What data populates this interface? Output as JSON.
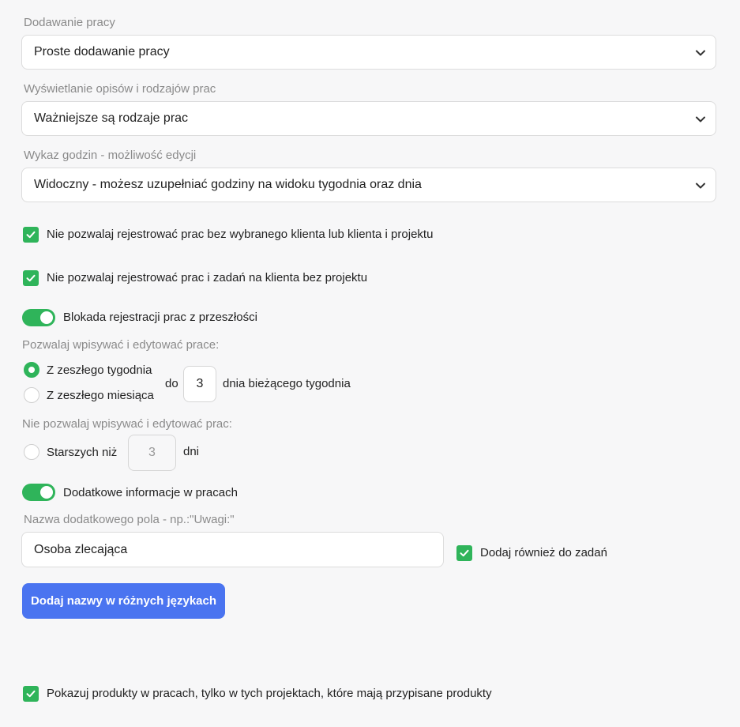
{
  "work_adding": {
    "label": "Dodawanie pracy",
    "value": "Proste dodawanie pracy"
  },
  "descriptions_display": {
    "label": "Wyświetlanie opisów i rodzajów prac",
    "value": "Ważniejsze są rodzaje prac"
  },
  "hours_list": {
    "label": "Wykaz godzin - możliwość edycji",
    "value": "Widoczny - możesz uzupełniać godziny na widoku tygodnia oraz dnia"
  },
  "checkbox_client": {
    "label": "Nie pozwalaj rejestrować prac bez wybranego klienta lub klienta i projektu",
    "checked": true
  },
  "checkbox_project": {
    "label": "Nie pozwalaj rejestrować prac i zadań na klienta bez projektu",
    "checked": true
  },
  "toggle_past": {
    "label": "Blokada rejestracji prac z przeszłości",
    "on": true
  },
  "allow_section": {
    "label": "Pozwalaj wpisywać i edytować prace:",
    "option_week": "Z zeszłego tygodnia",
    "option_month": "Z zeszłego miesiąca",
    "selected": "Z zeszłego tygodnia",
    "do_label": "do",
    "day_value": "3",
    "day_suffix": "dnia bieżącego tygodnia"
  },
  "deny_section": {
    "label": "Nie pozwalaj wpisywać i edytować prac:",
    "option_older": "Starszych niż",
    "days_value": "3",
    "days_suffix": "dni"
  },
  "toggle_extra": {
    "label": "Dodatkowe informacje w pracach",
    "on": true
  },
  "extra_field": {
    "label": "Nazwa dodatkowego pola - np.:\"Uwagi:\"",
    "value": "Osoba zlecająca",
    "also_tasks_label": "Dodaj również do zadań",
    "also_tasks_checked": true
  },
  "languages_button": "Dodaj nazwy w różnych językach",
  "checkbox_products": {
    "label": "Pokazuj produkty w pracach, tylko w tych projektach, które mają przypisane produkty",
    "checked": true
  },
  "colors": {
    "accent_green": "#2fb45a",
    "button_blue": "#4a74f0"
  }
}
